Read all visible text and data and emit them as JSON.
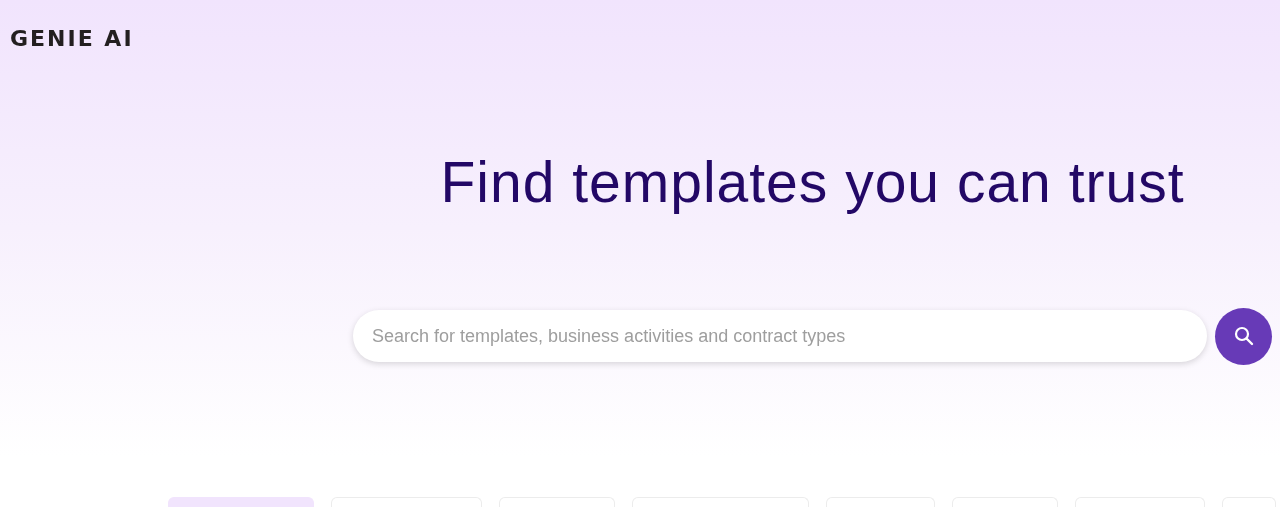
{
  "logo": "GENIE AI",
  "heading": "Find templates you can trust",
  "search": {
    "placeholder": "Search for templates, business activities and contract types"
  },
  "category_chips": [
    {
      "selected": true
    },
    {
      "selected": false
    },
    {
      "selected": false
    },
    {
      "selected": false
    },
    {
      "selected": false
    },
    {
      "selected": false
    },
    {
      "selected": false
    },
    {
      "selected": false
    }
  ]
}
